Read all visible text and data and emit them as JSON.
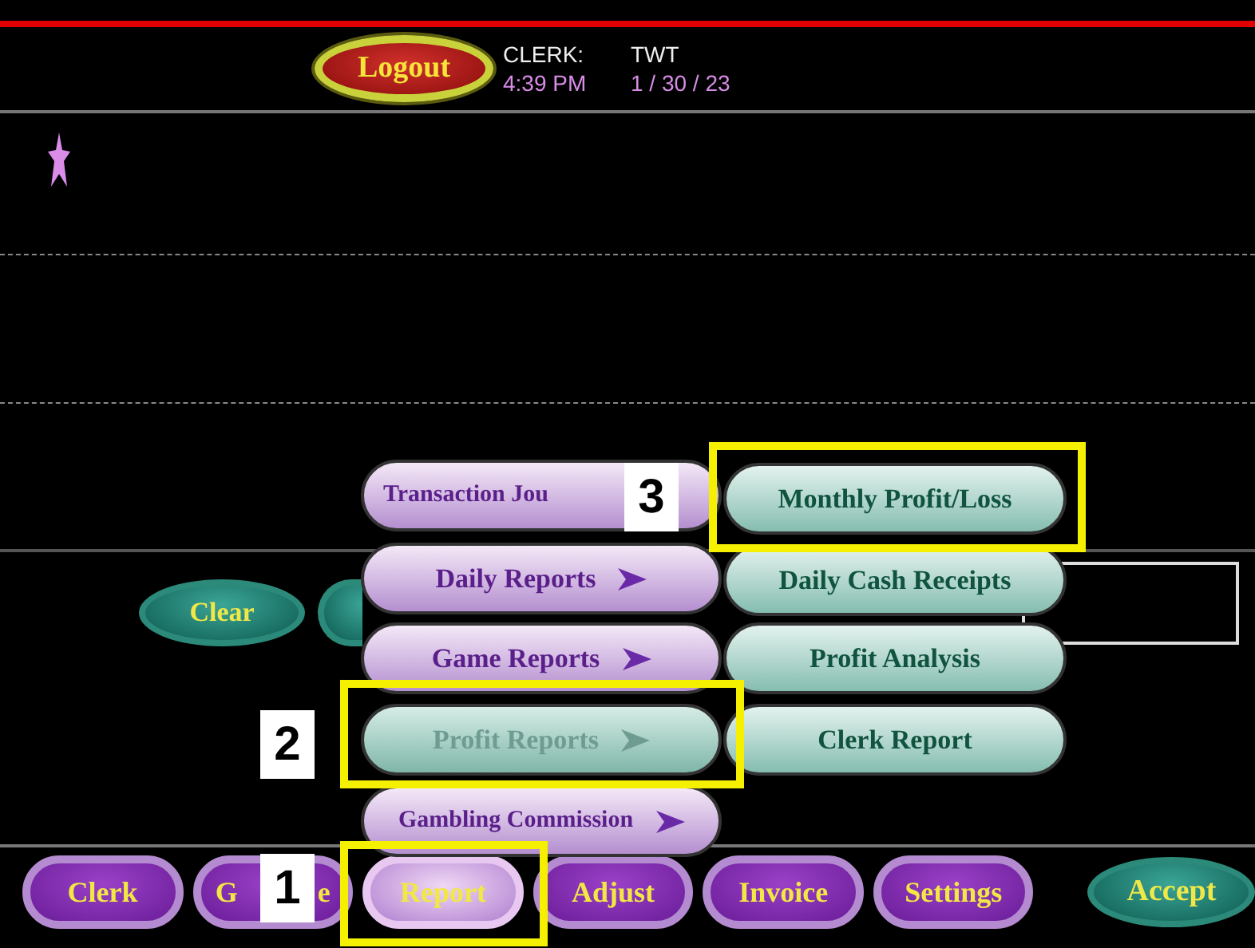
{
  "header": {
    "logout": "Logout",
    "clerk_label": "CLERK:",
    "clerk": "TWT",
    "time": "4:39 PM",
    "date": "1 / 30 / 23"
  },
  "clear_button": "Clear",
  "report_menu": [
    {
      "label": "Transaction Jou",
      "arrow": false,
      "selected": false
    },
    {
      "label": "Daily Reports",
      "arrow": true,
      "selected": false
    },
    {
      "label": "Game Reports",
      "arrow": true,
      "selected": false
    },
    {
      "label": "Profit Reports",
      "arrow": true,
      "selected": true
    },
    {
      "label": "Gambling Commission",
      "arrow": true,
      "selected": false
    }
  ],
  "profit_menu": [
    "Monthly Profit/Loss",
    "Daily Cash Receipts",
    "Profit Analysis",
    "Clerk Report"
  ],
  "bottom_bar": [
    {
      "label_parts": [
        "Clerk"
      ],
      "selected": false
    },
    {
      "label_parts": [
        "G",
        "e"
      ],
      "selected": false
    },
    {
      "label_parts": [
        "Report"
      ],
      "selected": true
    },
    {
      "label_parts": [
        "Adjust"
      ],
      "selected": false
    },
    {
      "label_parts": [
        "Invoice"
      ],
      "selected": false
    },
    {
      "label_parts": [
        "Settings"
      ],
      "selected": false
    }
  ],
  "accept_button": "Accept",
  "callouts": [
    "1",
    "2",
    "3"
  ]
}
